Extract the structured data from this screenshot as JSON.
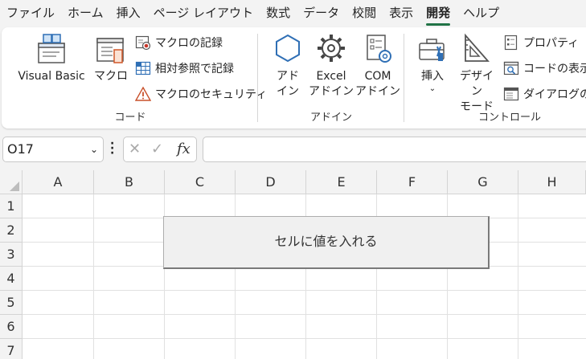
{
  "tabs": [
    {
      "label": "ファイル"
    },
    {
      "label": "ホーム"
    },
    {
      "label": "挿入"
    },
    {
      "label": "ページ レイアウト"
    },
    {
      "label": "数式"
    },
    {
      "label": "データ"
    },
    {
      "label": "校閲"
    },
    {
      "label": "表示"
    },
    {
      "label": "開発",
      "active": true
    },
    {
      "label": "ヘルプ"
    }
  ],
  "ribbon": {
    "code": {
      "label": "コード",
      "visual_basic": "Visual Basic",
      "macro": "マクロ",
      "record_macro": "マクロの記録",
      "relative_ref": "相対参照で記録",
      "macro_security": "マクロのセキュリティ"
    },
    "addins": {
      "label": "アドイン",
      "addin_line1": "アド",
      "addin_line2": "イン",
      "excel_line1": "Excel",
      "excel_line2": "アドイン",
      "com_line1": "COM",
      "com_line2": "アドイン"
    },
    "controls": {
      "label": "コントロール",
      "insert": "挿入",
      "insert_chevron": "⌄",
      "design_line1": "デザイン",
      "design_line2": "モード",
      "properties": "プロパティ",
      "view_code": "コードの表示",
      "run_dialog": "ダイアログの実"
    }
  },
  "formula_bar": {
    "name_box": "O17",
    "name_box_chevron": "⌄",
    "fx": "fx",
    "cancel_glyph": "✕",
    "enter_glyph": "✓",
    "formula": ""
  },
  "grid": {
    "columns": [
      "A",
      "B",
      "C",
      "D",
      "E",
      "F",
      "G",
      "H"
    ],
    "rows": [
      "1",
      "2",
      "3",
      "4",
      "5",
      "6",
      "7"
    ]
  },
  "form_button": {
    "label": "セルに値を入れる"
  },
  "colors": {
    "accent": "#217346"
  }
}
